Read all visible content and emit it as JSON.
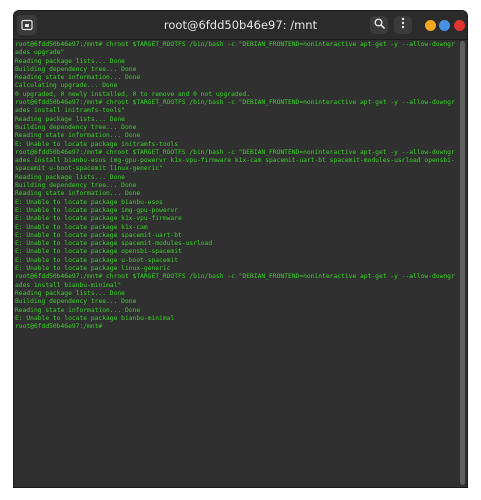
{
  "window": {
    "title": "root@6fdd50b46e97: /mnt"
  },
  "titlebar": {
    "new_tab_icon": "new-tab-icon",
    "search_icon": "search-icon",
    "menu_icon": "vertical-dots-icon"
  },
  "colors": {
    "terminal_bg": "#303030",
    "terminal_fg": "#3bd12b",
    "minimize": "#f5a623",
    "maximize": "#4a90e2",
    "close": "#e0342f",
    "scrollbar": "#5e5e5e"
  },
  "terminal": {
    "lines": [
      "root@6fdd50b46e97:/mnt# chroot $TARGET_ROOTFS /bin/bash -c \"DEBIAN_FRONTEND=noninteractive apt-get -y --allow-downgrades upgrade\"",
      "Reading package lists... Done",
      "Building dependency tree... Done",
      "Reading state information... Done",
      "Calculating upgrade... Done",
      "0 upgraded, 0 newly installed, 0 to remove and 0 not upgraded.",
      "root@6fdd50b46e97:/mnt# chroot $TARGET_ROOTFS /bin/bash -c \"DEBIAN_FRONTEND=noninteractive apt-get -y --allow-downgrades install initramfs-tools\"",
      "Reading package lists... Done",
      "Building dependency tree... Done",
      "Reading state information... Done",
      "E: Unable to locate package initramfs-tools",
      "root@6fdd50b46e97:/mnt# chroot $TARGET_ROOTFS /bin/bash -c \"DEBIAN_FRONTEND=noninteractive apt-get -y --allow-downgrades install bianbu-esos img-gpu-powervr k1x-vpu-firmware k1x-cam spacemit-uart-bt spacemit-modules-usrload opensbi-spacemit u-boot-spacemit linux-generic\"",
      "Reading package lists... Done",
      "Building dependency tree... Done",
      "Reading state information... Done",
      "E: Unable to locate package bianbu-esos",
      "E: Unable to locate package img-gpu-powervr",
      "E: Unable to locate package k1x-vpu-firmware",
      "E: Unable to locate package k1x-cam",
      "E: Unable to locate package spacemit-uart-bt",
      "E: Unable to locate package spacemit-modules-usrload",
      "E: Unable to locate package opensbi-spacemit",
      "E: Unable to locate package u-boot-spacemit",
      "E: Unable to locate package linux-generic",
      "root@6fdd50b46e97:/mnt# chroot $TARGET_ROOTFS /bin/bash -c \"DEBIAN_FRONTEND=noninteractive apt-get -y --allow-downgrades install bianbu-minimal\"",
      "Reading package lists... Done",
      "Building dependency tree... Done",
      "Reading state information... Done",
      "E: Unable to locate package bianbu-minimal",
      "root@6fdd50b46e97:/mnt# "
    ]
  }
}
